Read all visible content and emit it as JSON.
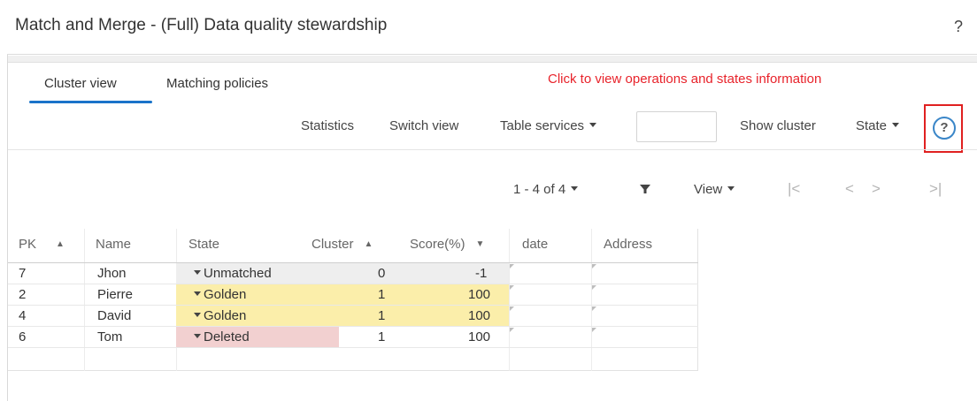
{
  "window": {
    "title": "Match and Merge - (Full) Data quality stewardship",
    "help_label": "?"
  },
  "tabs": [
    {
      "label": "Cluster view",
      "active": true
    },
    {
      "label": "Matching policies",
      "active": false
    }
  ],
  "annotation": "Click to view operations and states information",
  "toolbar": {
    "statistics": "Statistics",
    "switch_view": "Switch view",
    "table_services": "Table services",
    "search_value": "",
    "show_cluster": "Show cluster",
    "state": "State",
    "help": "?"
  },
  "pager": {
    "range": "1 - 4 of 4",
    "view": "View",
    "first": "|<",
    "prev": "<",
    "next": ">",
    "last": ">|"
  },
  "table": {
    "columns": [
      "PK",
      "Name",
      "State",
      "Cluster",
      "Score(%)",
      "date",
      "Address"
    ],
    "pk_sort": "asc",
    "cluster_sort": "asc",
    "score_sort": "desc",
    "rows": [
      {
        "pk": "7",
        "name": "Jhon",
        "state": "Unmatched",
        "cluster": "0",
        "score": "-1",
        "date": "",
        "address": "",
        "color": "#eeeeee"
      },
      {
        "pk": "2",
        "name": "Pierre",
        "state": "Golden",
        "cluster": "1",
        "score": "100",
        "date": "",
        "address": "",
        "color": "#fbeeaa"
      },
      {
        "pk": "4",
        "name": "David",
        "state": "Golden",
        "cluster": "1",
        "score": "100",
        "date": "",
        "address": "",
        "color": "#fbeeaa"
      },
      {
        "pk": "6",
        "name": "Tom",
        "state": "Deleted",
        "cluster": "1",
        "score": "100",
        "date": "",
        "address": "",
        "color": "#f2d0d0"
      }
    ]
  },
  "colors": {
    "accent": "#1a73c9",
    "annotation": "#e8232b",
    "highlight_box": "#e02020"
  }
}
